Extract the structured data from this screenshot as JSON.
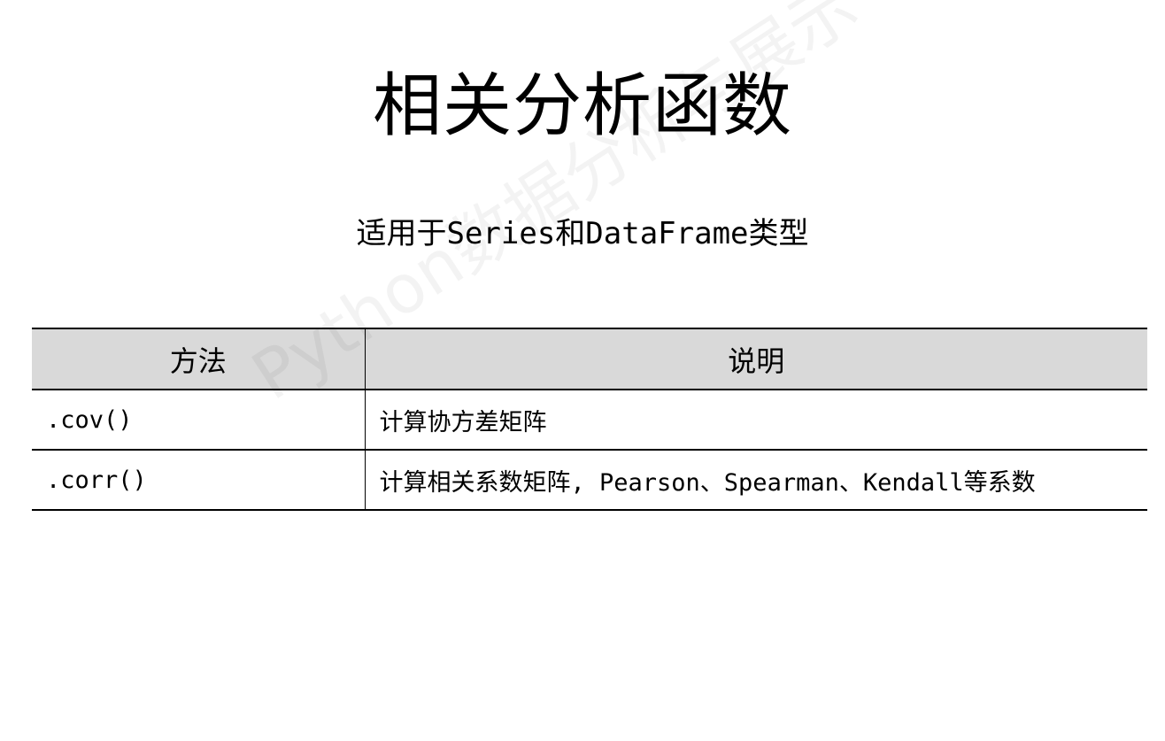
{
  "slide": {
    "title": "相关分析函数",
    "subtitle": "适用于Series和DataFrame类型",
    "watermark": "Python数据分析与展示"
  },
  "table": {
    "headers": [
      "方法",
      "说明"
    ],
    "rows": [
      {
        "method": ".cov()",
        "description": "计算协方差矩阵"
      },
      {
        "method": ".corr()",
        "description": "计算相关系数矩阵, Pearson、Spearman、Kendall等系数"
      }
    ]
  }
}
